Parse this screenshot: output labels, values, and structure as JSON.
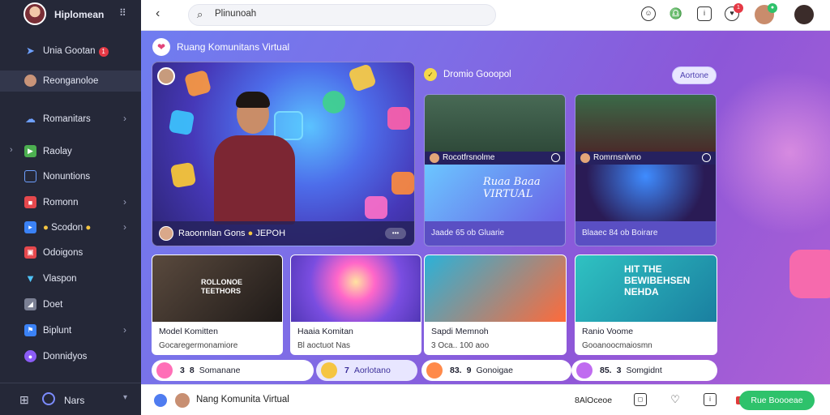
{
  "app": {
    "name": "Hiplomean"
  },
  "sidebar": {
    "items": [
      {
        "label": "Unia Gootan",
        "icon": "paper-plane-icon",
        "badge": "1"
      },
      {
        "label": "Reonganoloe",
        "icon": "avatar"
      },
      {
        "label": "Romanitars",
        "icon": "cloud-icon"
      },
      {
        "label": "Raolay",
        "icon": "play-icon"
      },
      {
        "label": "Nonuntions",
        "icon": "tv-icon"
      },
      {
        "label": "Romonn",
        "icon": "video-icon"
      },
      {
        "label": "Scodon",
        "icon": "stream-icon"
      },
      {
        "label": "Odoigons",
        "icon": "photo-icon"
      },
      {
        "label": "Vlaspon",
        "icon": "shield-icon"
      },
      {
        "label": "Doet",
        "icon": "bell-icon"
      },
      {
        "label": "Biplunt",
        "icon": "flag-icon"
      },
      {
        "label": "Donnidyos",
        "icon": "chat-icon"
      }
    ],
    "footer_label": "Nars"
  },
  "topbar": {
    "search_value": "Plinunoah",
    "notif_badge": "1"
  },
  "main": {
    "title": "Ruang Komunitans Virtual",
    "hero": {
      "caption": "Raoonnlan  Gons",
      "caption_extra": "JEPOH",
      "more": "•••"
    },
    "recommend": {
      "title": "Dromio Gooopol",
      "button": "Aortone",
      "cards": [
        {
          "mid": "Rocotfrsnolme",
          "foot": "Jaade 65 ob Gluarie",
          "banner": "Ruaa Baaa VIRTUAL"
        },
        {
          "mid": "Romrnsnlvno",
          "foot": "Blaaec 84 ob Boirare"
        }
      ]
    },
    "cards": [
      {
        "title": "Model Komitten",
        "sub": "Gocaregermonamiore",
        "banner": "ROLLONOE TEETHORS"
      },
      {
        "title": "Haaia Komitan",
        "sub": "Bl aoctuot Nas"
      },
      {
        "title": "Sapdi Memnoh",
        "sub": "3 Oca..  100 aoo"
      },
      {
        "title": "Ranio Voome",
        "sub": "Gooanoocmaiosmn",
        "banner": "HIT THE BEWIBEHSEN NEHDA"
      }
    ],
    "pills": [
      {
        "num": "3",
        "num2": "8",
        "label": "Somanane"
      },
      {
        "num": "7",
        "label": "Aorlotano"
      },
      {
        "num": "83.",
        "num2": "9",
        "label": "Gonoigae"
      },
      {
        "num": "85.",
        "num2": "3",
        "label": "Somgidnt"
      }
    ]
  },
  "bottombar": {
    "title": "Nang Komunita Virtual",
    "right_label": "8AlOceoe",
    "join_label": "Rue Boooeae"
  },
  "colors": {
    "accent": "#6f7df0",
    "brand_purple": "#8c57d8",
    "join_green": "#2ec26b",
    "badge_red": "#e53945"
  }
}
